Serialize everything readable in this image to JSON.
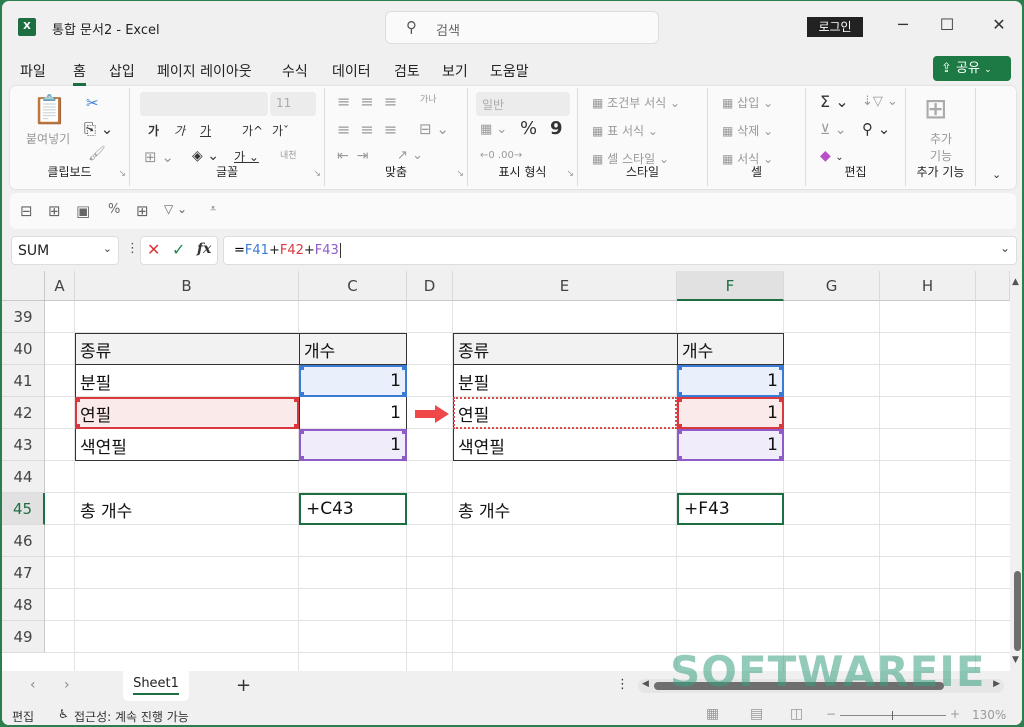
{
  "app": {
    "title": "통합 문서2  -  Excel",
    "logo": "X"
  },
  "search": {
    "placeholder": "검색",
    "icon": "search-icon"
  },
  "login_label": "로그인",
  "window_controls": {
    "minimize": "─",
    "maximize": "☐",
    "close": "✕"
  },
  "menu": [
    "파일",
    "홈",
    "삽입",
    "페이지 레이아웃",
    "수식",
    "데이터",
    "검토",
    "보기",
    "도움말"
  ],
  "active_menu": "홈",
  "share": {
    "label": "공유",
    "icon": "share-icon"
  },
  "ribbon": {
    "clipboard": {
      "label": "클립보드",
      "paste": "붙여넣기"
    },
    "font": {
      "label": "글꼴",
      "font_name": "",
      "font_size": "11",
      "bold": "가",
      "italic": "가",
      "underline": "가",
      "grow": "가^",
      "shrink": "가ˇ",
      "phonetic": "내천"
    },
    "alignment": {
      "label": "맞춤"
    },
    "number": {
      "label": "표시 형식",
      "format": "일반",
      "percent": "%",
      "comma": "9"
    },
    "styles": {
      "label": "스타일",
      "conditional": "조건부 서식",
      "table": "표 서식",
      "cell_styles": "셀 스타일"
    },
    "cells": {
      "label": "셀",
      "insert": "삽입",
      "delete": "삭제",
      "format": "서식"
    },
    "editing": {
      "label": "편집",
      "sum": "Σ"
    },
    "addins": {
      "label": "추가 기능",
      "button": "추가 기능"
    }
  },
  "formula_bar": {
    "name_box": "SUM",
    "formula_prefix": "=",
    "refs": [
      {
        "text": "F41",
        "color": "#3a7bd5"
      },
      {
        "text": "+",
        "color": "#222"
      },
      {
        "text": "F42",
        "color": "#d9393e"
      },
      {
        "text": "+",
        "color": "#222"
      },
      {
        "text": "F43",
        "color": "#8e5cc9"
      }
    ]
  },
  "columns": [
    "A",
    "B",
    "C",
    "D",
    "E",
    "F",
    "G",
    "H"
  ],
  "selected_column": "F",
  "rows": [
    "39",
    "40",
    "41",
    "42",
    "43",
    "44",
    "45",
    "46",
    "47",
    "48",
    "49"
  ],
  "selected_row": "45",
  "left_table": {
    "header": [
      "종류",
      "개수"
    ],
    "rows": [
      [
        "분필",
        "1"
      ],
      [
        "연필",
        "1"
      ],
      [
        "색연필",
        "1"
      ]
    ],
    "total_label": "총 개수",
    "total_value": "+C43"
  },
  "right_table": {
    "header": [
      "종류",
      "개수"
    ],
    "rows": [
      [
        "분필",
        "1"
      ],
      [
        "연필",
        "1"
      ],
      [
        "색연필",
        "1"
      ]
    ],
    "total_label": "총 개수",
    "total_value": "+F43"
  },
  "highlight_colors": {
    "blue": "#3a7bd5",
    "red": "#d9393e",
    "purple": "#8e5cc9",
    "green": "#1d6f42"
  },
  "sheet_tabs": [
    "Sheet1"
  ],
  "status": {
    "mode": "편집",
    "accessibility": "접근성: 계속 진행 가능",
    "zoom": "130%"
  },
  "watermark": "SOFTWAREIE"
}
